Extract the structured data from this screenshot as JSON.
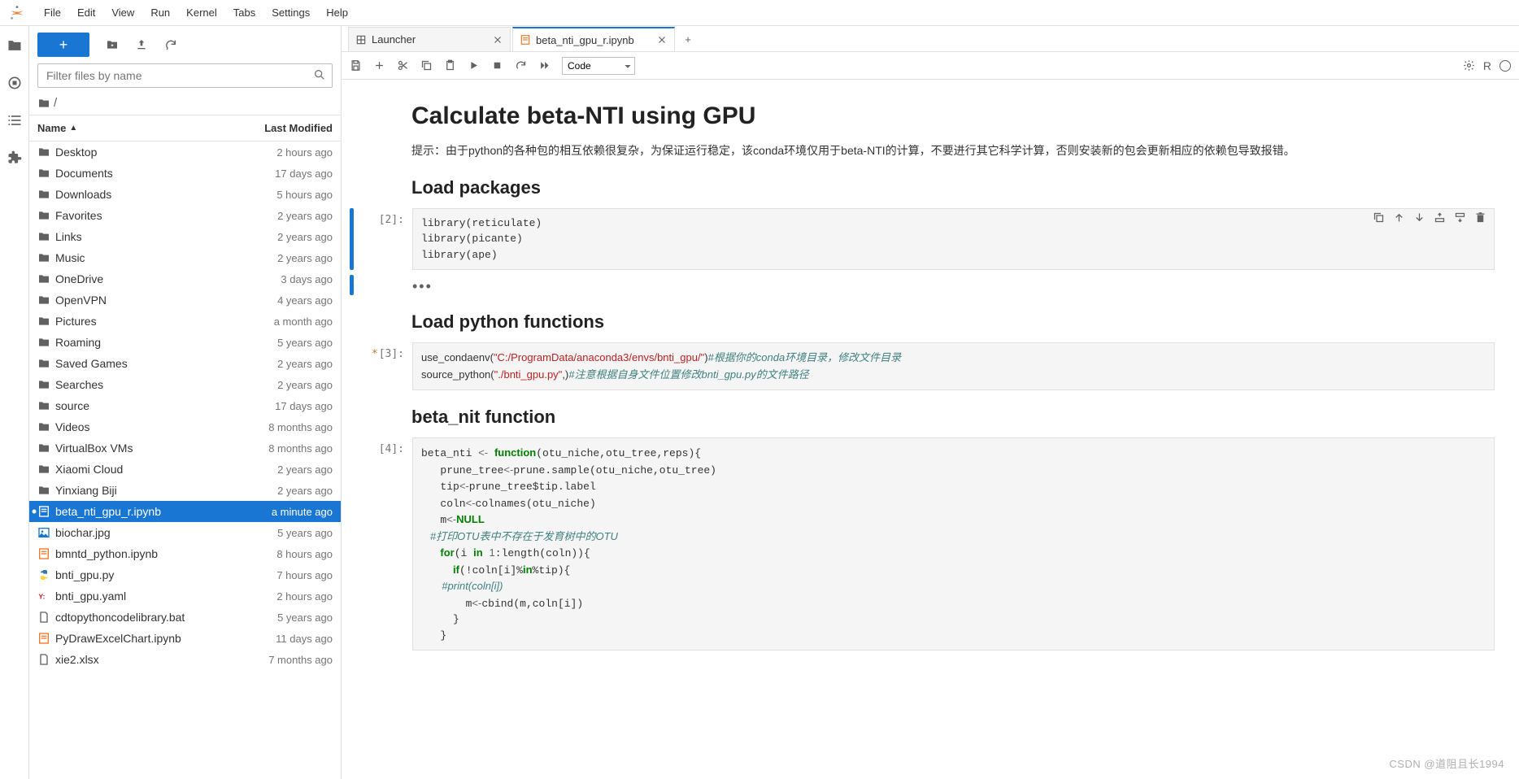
{
  "menu": [
    "File",
    "Edit",
    "View",
    "Run",
    "Kernel",
    "Tabs",
    "Settings",
    "Help"
  ],
  "sidebar": {
    "filter_placeholder": "Filter files by name",
    "breadcrumb": "/",
    "headers": {
      "name": "Name",
      "modified": "Last Modified"
    },
    "files": [
      {
        "icon": "folder",
        "name": "Desktop",
        "modified": "2 hours ago"
      },
      {
        "icon": "folder",
        "name": "Documents",
        "modified": "17 days ago"
      },
      {
        "icon": "folder",
        "name": "Downloads",
        "modified": "5 hours ago"
      },
      {
        "icon": "folder",
        "name": "Favorites",
        "modified": "2 years ago"
      },
      {
        "icon": "folder",
        "name": "Links",
        "modified": "2 years ago"
      },
      {
        "icon": "folder",
        "name": "Music",
        "modified": "2 years ago"
      },
      {
        "icon": "folder",
        "name": "OneDrive",
        "modified": "3 days ago"
      },
      {
        "icon": "folder",
        "name": "OpenVPN",
        "modified": "4 years ago"
      },
      {
        "icon": "folder",
        "name": "Pictures",
        "modified": "a month ago"
      },
      {
        "icon": "folder",
        "name": "Roaming",
        "modified": "5 years ago"
      },
      {
        "icon": "folder",
        "name": "Saved Games",
        "modified": "2 years ago"
      },
      {
        "icon": "folder",
        "name": "Searches",
        "modified": "2 years ago"
      },
      {
        "icon": "folder",
        "name": "source",
        "modified": "17 days ago"
      },
      {
        "icon": "folder",
        "name": "Videos",
        "modified": "8 months ago"
      },
      {
        "icon": "folder",
        "name": "VirtualBox VMs",
        "modified": "8 months ago"
      },
      {
        "icon": "folder",
        "name": "Xiaomi Cloud",
        "modified": "2 years ago"
      },
      {
        "icon": "folder",
        "name": "Yinxiang Biji",
        "modified": "2 years ago"
      },
      {
        "icon": "notebook",
        "name": "beta_nti_gpu_r.ipynb",
        "modified": "a minute ago",
        "selected": true,
        "dot": true
      },
      {
        "icon": "image",
        "name": "biochar.jpg",
        "modified": "5 years ago"
      },
      {
        "icon": "notebook",
        "name": "bmntd_python.ipynb",
        "modified": "8 hours ago"
      },
      {
        "icon": "python",
        "name": "bnti_gpu.py",
        "modified": "7 hours ago"
      },
      {
        "icon": "yaml",
        "name": "bnti_gpu.yaml",
        "modified": "2 hours ago"
      },
      {
        "icon": "file",
        "name": "cdtopythoncodelibrary.bat",
        "modified": "5 years ago"
      },
      {
        "icon": "notebook",
        "name": "PyDrawExcelChart.ipynb",
        "modified": "11 days ago"
      },
      {
        "icon": "file",
        "name": "xie2.xlsx",
        "modified": "7 months ago"
      }
    ]
  },
  "tabs": [
    {
      "icon": "launcher",
      "label": "Launcher",
      "active": false
    },
    {
      "icon": "notebook",
      "label": "beta_nti_gpu_r.ipynb",
      "active": true
    }
  ],
  "toolbar": {
    "celltype": "Code",
    "kernel": "R"
  },
  "notebook": {
    "title": "Calculate beta-NTI using GPU",
    "intro": "提示：由于python的各种包的相互依赖很复杂，为保证运行稳定，该conda环境仅用于beta-NTI的计算，不要进行其它科学计算，否则安装新的包会更新相应的依赖包导致报错。",
    "h2_load": "Load packages",
    "cell1_prompt": "[2]:",
    "cell1_code": "library(reticulate)\nlibrary(picante)\nlibrary(ape)",
    "collapsed": "•••",
    "h2_py": "Load python functions",
    "cell2_prompt": "[3]:",
    "cell2_line1_pre": "use_condaenv(",
    "cell2_line1_str": "\"C:/ProgramData/anaconda3/envs/bnti_gpu/\"",
    "cell2_line1_post": ")",
    "cell2_line1_com": "#根据你的conda环境目录，修改文件目录",
    "cell2_line2_pre": "source_python(",
    "cell2_line2_str": "\"./bnti_gpu.py\"",
    "cell2_line2_post": ",)",
    "cell2_line2_com": "#注意根据自身文件位置修改bnti_gpu.py的文件路径",
    "h2_fn": "beta_nit function",
    "cell3_prompt": "[4]:",
    "cell3_code_lines": [
      "beta_nti <- function(otu_niche,otu_tree,reps){",
      "   prune_tree<-prune.sample(otu_niche,otu_tree)",
      "   tip<-prune_tree$tip.label",
      "   coln<-colnames(otu_niche)",
      "   m<-NULL",
      "   #打印OTU表中不存在于发育树中的OTU",
      "   for(i in 1:length(coln)){",
      "     if(!coln[i]%in%tip){",
      "       #print(coln[i])",
      "       m<-cbind(m,coln[i])",
      "     }",
      "   }"
    ]
  },
  "watermark": "CSDN @道阻且长1994"
}
